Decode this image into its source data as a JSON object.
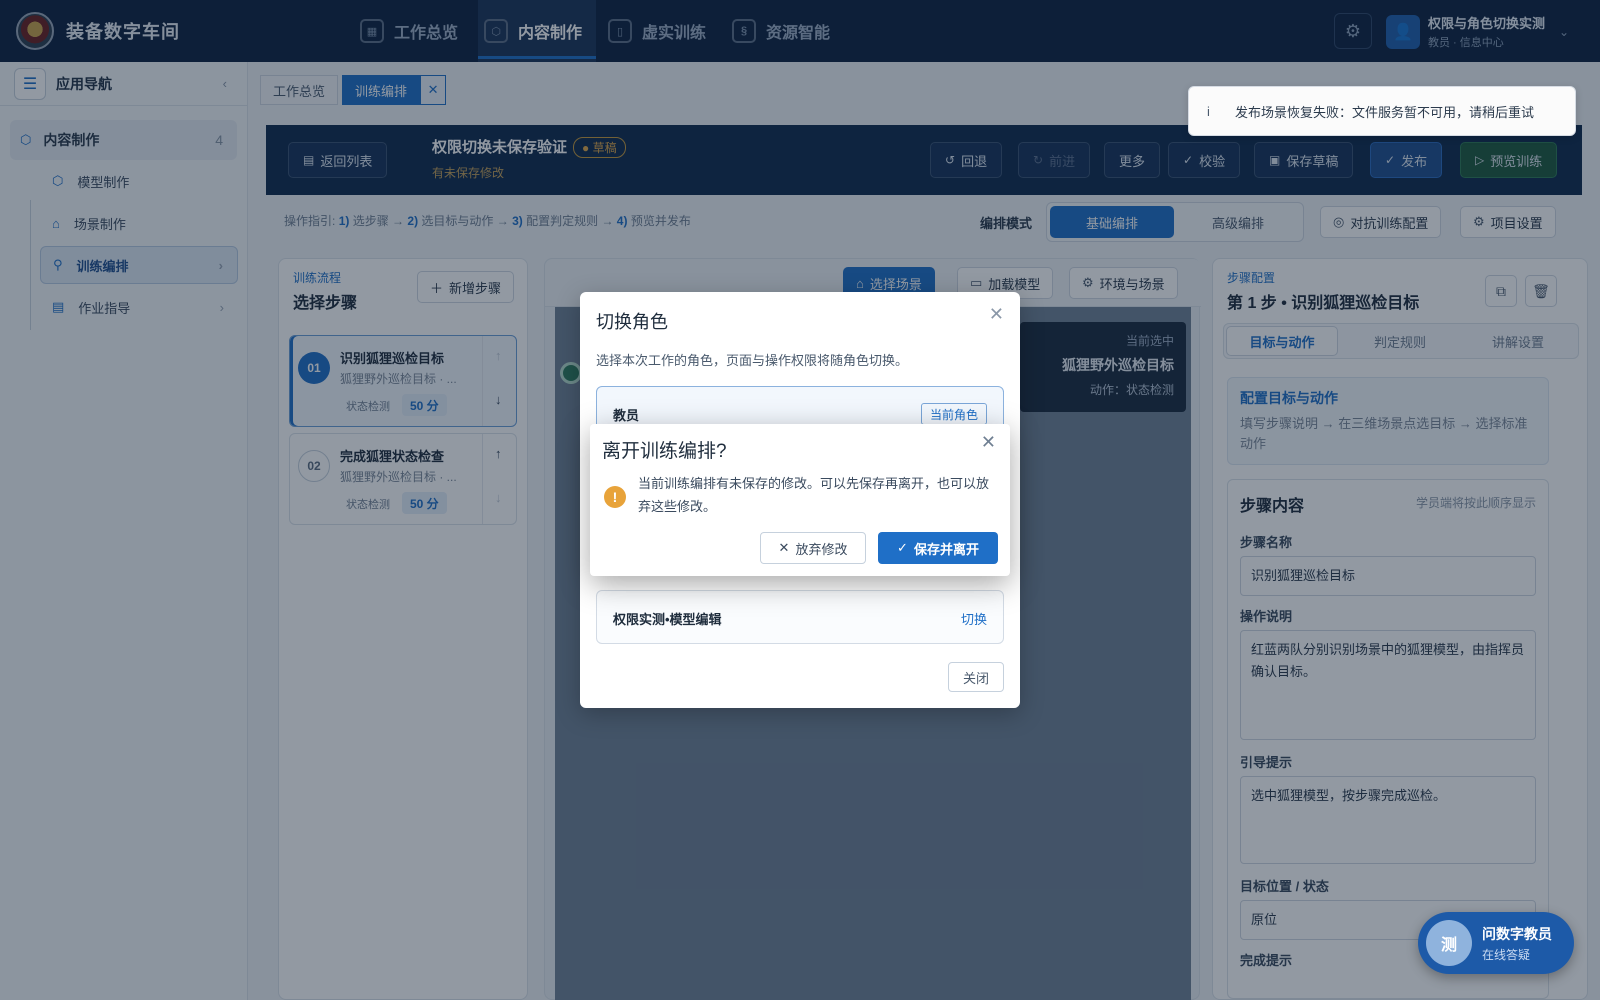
{
  "app": {
    "title": "装备数字车间"
  },
  "topnav": [
    {
      "label": "工作总览",
      "icon": "grid-icon"
    },
    {
      "label": "内容制作",
      "icon": "cube-icon",
      "active": true
    },
    {
      "label": "虚实训练",
      "icon": "book-icon"
    },
    {
      "label": "资源智能",
      "icon": "ai-icon"
    }
  ],
  "user": {
    "name": "权限与角色切换实测",
    "sub": "教员 · 信息中心"
  },
  "sidebar": {
    "title": "应用导航",
    "group": {
      "label": "内容制作",
      "count": "4"
    },
    "items": [
      {
        "label": "模型制作"
      },
      {
        "label": "场景制作"
      },
      {
        "label": "训练编排",
        "active": true
      },
      {
        "label": "作业指导"
      }
    ]
  },
  "tabs": [
    {
      "label": "工作总览"
    },
    {
      "label": "训练编排",
      "active": true
    }
  ],
  "editor": {
    "back_label": "返回列表",
    "doc_title": "权限切换未保存验证",
    "draft_badge": "草稿",
    "unsaved": "有未保存修改",
    "undo": "回退",
    "redo": "前进",
    "more": "更多",
    "validate": "校验",
    "save_draft": "保存草稿",
    "publish": "发布",
    "preview": "预览训练"
  },
  "guide": {
    "prefix": "操作指引:",
    "s1n": "1)",
    "s1": "选步骤 →",
    "s2n": "2)",
    "s2": "选目标与动作 →",
    "s3n": "3)",
    "s3": "配置判定规则 →",
    "s4n": "4)",
    "s4": "预览并发布"
  },
  "mode": {
    "label": "编排模式",
    "basic": "基础编排",
    "advanced": "高级编排"
  },
  "tools": {
    "adversarial": "对抗训练配置",
    "project": "项目设置"
  },
  "steps_panel": {
    "kicker": "训练流程",
    "title": "选择步骤",
    "add": "新增步骤",
    "steps": [
      {
        "num": "01",
        "name": "识别狐狸巡检目标",
        "sub": "狐狸野外巡检目标 · ...",
        "type": "状态检测",
        "score": "50 分"
      },
      {
        "num": "02",
        "name": "完成狐狸状态检查",
        "sub": "狐狸野外巡检目标 · ...",
        "type": "状态检测",
        "score": "50 分"
      }
    ]
  },
  "viewport": {
    "select_scene": "选择场景",
    "load_model": "加载模型",
    "env": "环境与场景",
    "sel_kicker": "当前选中",
    "sel_name": "狐狸野外巡检目标",
    "sel_action": "动作：状态检测"
  },
  "right_panel": {
    "kicker": "步骤配置",
    "title": "第 1 步 • 识别狐狸巡检目标",
    "tabs": [
      "目标与动作",
      "判定规则",
      "讲解设置"
    ],
    "hint_title": "配置目标与动作",
    "hint_desc": "填写步骤说明 → 在三维场景点选目标 → 选择标准动作",
    "section_title": "步骤内容",
    "section_note": "学员端将按此顺序显示",
    "name_label": "步骤名称",
    "name_value": "识别狐狸巡检目标",
    "op_label": "操作说明",
    "op_value": "红蓝两队分别识别场景中的狐狸模型，由指挥员确认目标。",
    "tip_label": "引导提示",
    "tip_value": "选中狐狸模型，按步骤完成巡检。",
    "pos_label": "目标位置 / 状态",
    "pos_value": "原位",
    "done_label": "完成提示"
  },
  "toast": {
    "text": "发布场景恢复失败：文件服务暂不可用，请稍后重试"
  },
  "role_dialog": {
    "title": "切换角色",
    "desc": "选择本次工作的角色，页面与操作权限将随角色切换。",
    "role1": "教员",
    "current_tag": "当前角色",
    "role2": "权限实测•模型编辑",
    "switch_label": "切换",
    "close_label": "关闭"
  },
  "confirm": {
    "title": "离开训练编排?",
    "message": "当前训练编排有未保存的修改。可以先保存再离开，也可以放弃这些修改。",
    "discard": "放弃修改",
    "save_leave": "保存并离开"
  },
  "assistant": {
    "avatar": "测",
    "name": "问数字教员",
    "sub": "在线答疑"
  }
}
